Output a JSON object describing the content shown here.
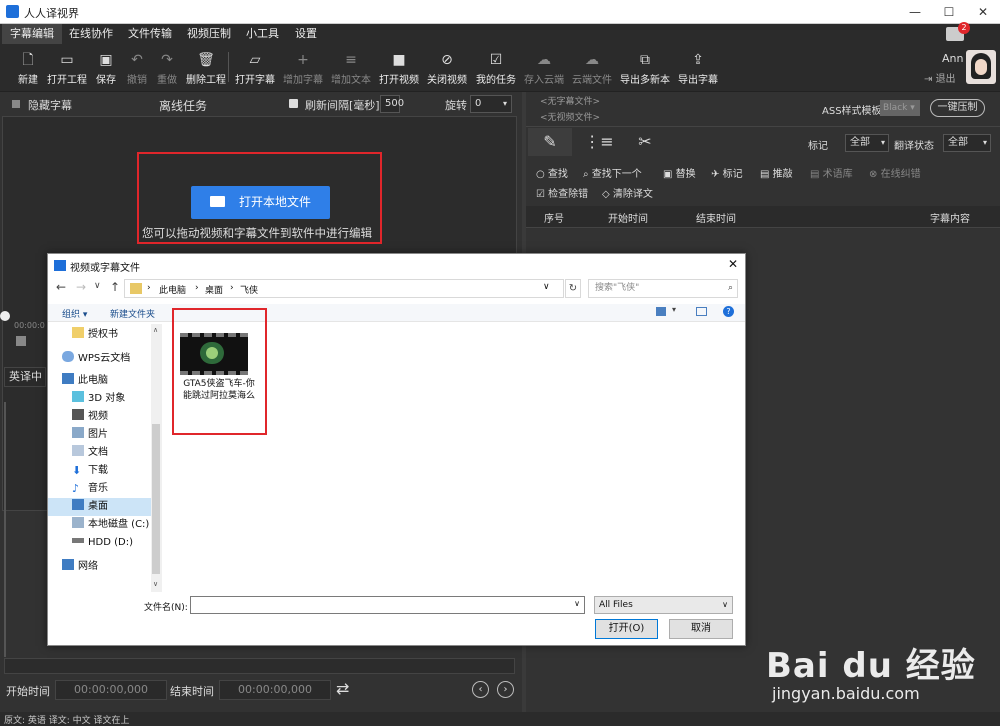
{
  "app": {
    "title": "人人译视界"
  },
  "menu": [
    "字幕编辑",
    "在线协作",
    "文件传输",
    "视频压制",
    "小工具",
    "设置"
  ],
  "toolbar": {
    "new": "新建",
    "open_project": "打开工程",
    "save": "保存",
    "undo": "撤销",
    "redo": "重做",
    "delete_project": "删除工程",
    "open_subtitle": "打开字幕",
    "add_subtitle": "增加字幕",
    "add_text": "增加文本",
    "open_video": "打开视频",
    "close_video": "关闭视频",
    "my_tasks": "我的任务",
    "save_cloud": "存入云端",
    "cloud_files": "云端文件",
    "export_multi": "导出多新本",
    "export_subtitle": "导出字幕"
  },
  "user": {
    "name": "Ann",
    "logout": "退出",
    "badge": "2"
  },
  "left": {
    "hide_subtitle": "隐藏字幕",
    "offline_task": "离线任务",
    "refresh_label": "刷新间隔[毫秒]",
    "refresh_value": "500",
    "rotate_label": "旋转",
    "rotate_value": "0",
    "open_local_file": "打开本地文件",
    "drag_hint": "您可以拖动视频和字幕文件到软件中进行编辑",
    "time_small": "00:00:0",
    "lang_label": "英译中",
    "start_time_label": "开始时间",
    "start_time_value": "00:00:00,000",
    "end_time_label": "结束时间",
    "end_time_value": "00:00:00,000"
  },
  "right": {
    "no_subtitle_file": "<无字幕文件>",
    "no_video_file": "<无视频文件>",
    "ass_label": "ASS样式模板",
    "ass_value": "Black",
    "one_key": "一键压制",
    "mark_label": "标记",
    "mark_value": "全部",
    "trans_status_label": "翻译状态",
    "trans_status_value": "全部",
    "find": "查找",
    "find_next": "查找下一个",
    "replace": "替换",
    "mark": "标记",
    "push": "推敲",
    "term_lib": "术语库",
    "online_correct": "在线纠错",
    "check_remove": "检查除错",
    "clear_trans": "清除译文",
    "columns": [
      "序号",
      "开始时间",
      "结束时间",
      "字幕内容"
    ]
  },
  "dialog": {
    "title": "视频或字幕文件",
    "breadcrumb": [
      "此电脑",
      "桌面",
      "飞侠"
    ],
    "search_placeholder": "搜索\"飞侠\"",
    "organize": "组织 ▾",
    "new_folder": "新建文件夹",
    "nav": [
      "授权书",
      "WPS云文档",
      "此电脑",
      "3D 对象",
      "视频",
      "图片",
      "文档",
      "下载",
      "音乐",
      "桌面",
      "本地磁盘 (C:)",
      "HDD (D:)",
      "网络"
    ],
    "file_name": "GTA5侠盗飞车-你能跳过阿拉莫海么",
    "filename_label": "文件名(N):",
    "filename_value": "",
    "filter_value": "All Files",
    "open_btn": "打开(O)",
    "cancel_btn": "取消"
  },
  "status": {
    "text": "原文: 英语  译文: 中文    译文在上"
  },
  "watermark": {
    "brand": "Bai du 经验",
    "url": "jingyan.baidu.com"
  }
}
